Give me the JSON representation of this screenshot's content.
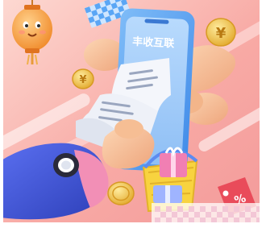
{
  "illustration": {
    "phone_title": "丰收互联",
    "coin_symbol": "¥",
    "tag_symbol": "%",
    "colors": {
      "background_pink": "#f6a3a0",
      "background_light": "#fde7e3",
      "phone_blue": "#58a6f2",
      "phone_screen": "#9ec9fa",
      "hand_skin": "#f7c39b",
      "sleeve_blue": "#3d55d6",
      "coin_gold": "#f3c84b",
      "lantern_orange": "#f6a440",
      "basket_yellow": "#f8d33f",
      "gift_pink": "#f17fb3",
      "tag_red": "#e94b5a",
      "receipt_white": "#f4f6fb"
    },
    "icons": [
      "lantern-icon",
      "coin-icon",
      "receipt-icon",
      "shopping-basket-icon",
      "gift-box-icon",
      "price-tag-icon"
    ]
  }
}
